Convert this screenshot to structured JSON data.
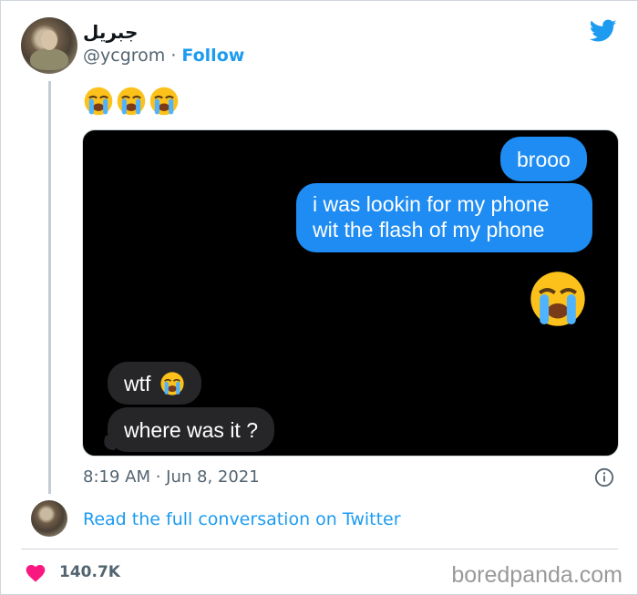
{
  "tweet": {
    "display_name": "جبريل",
    "handle": "@ycgrom",
    "separator": " · ",
    "follow_label": "Follow",
    "text_emojis": "😭😭😭",
    "timestamp": "8:19 AM · Jun 8, 2021",
    "read_conversation": "Read the full conversation on Twitter",
    "likes": "140.7K"
  },
  "conversation": {
    "messages": [
      {
        "from": "me",
        "text": "brooo"
      },
      {
        "from": "me",
        "lines": [
          "i was lookin for my phone",
          "wit the flash of my phone"
        ]
      },
      {
        "from": "me",
        "emoji": "loudly-crying-face"
      },
      {
        "from": "them",
        "text": "wtf"
      },
      {
        "from": "them",
        "text": "where was it ?"
      }
    ]
  },
  "watermark": "boredpanda.com",
  "colors": {
    "twitter_blue": "#1d9bf0",
    "imessage_blue": "#1e8cf2",
    "received_gray": "#262629",
    "like_pink": "#f91880"
  }
}
